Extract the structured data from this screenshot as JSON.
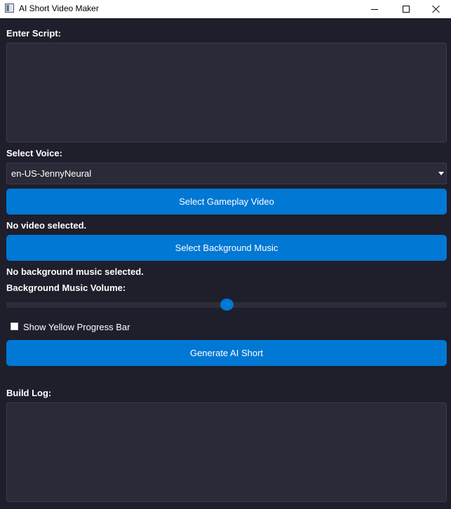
{
  "window": {
    "title": "AI Short Video Maker",
    "minimize_glyph": "minimize",
    "maximize_glyph": "maximize",
    "close_glyph": "close"
  },
  "script_section": {
    "label": "Enter Script:",
    "value": ""
  },
  "voice_section": {
    "label": "Select Voice:",
    "selected": "en-US-JennyNeural"
  },
  "video": {
    "button_label": "Select Gameplay Video",
    "status": "No video selected."
  },
  "music": {
    "button_label": "Select Background Music",
    "status": "No background music selected.",
    "volume_label": "Background Music Volume:",
    "volume_level": 0.5
  },
  "progress_bar_option": {
    "label": "Show Yellow Progress Bar",
    "checked": false
  },
  "generate": {
    "button_label": "Generate AI Short"
  },
  "build_log": {
    "label": "Build Log:",
    "value": ""
  },
  "colors": {
    "background": "#1f1e2b",
    "field": "#2b2a38",
    "accent": "#0078d4",
    "text": "#ffffff"
  }
}
